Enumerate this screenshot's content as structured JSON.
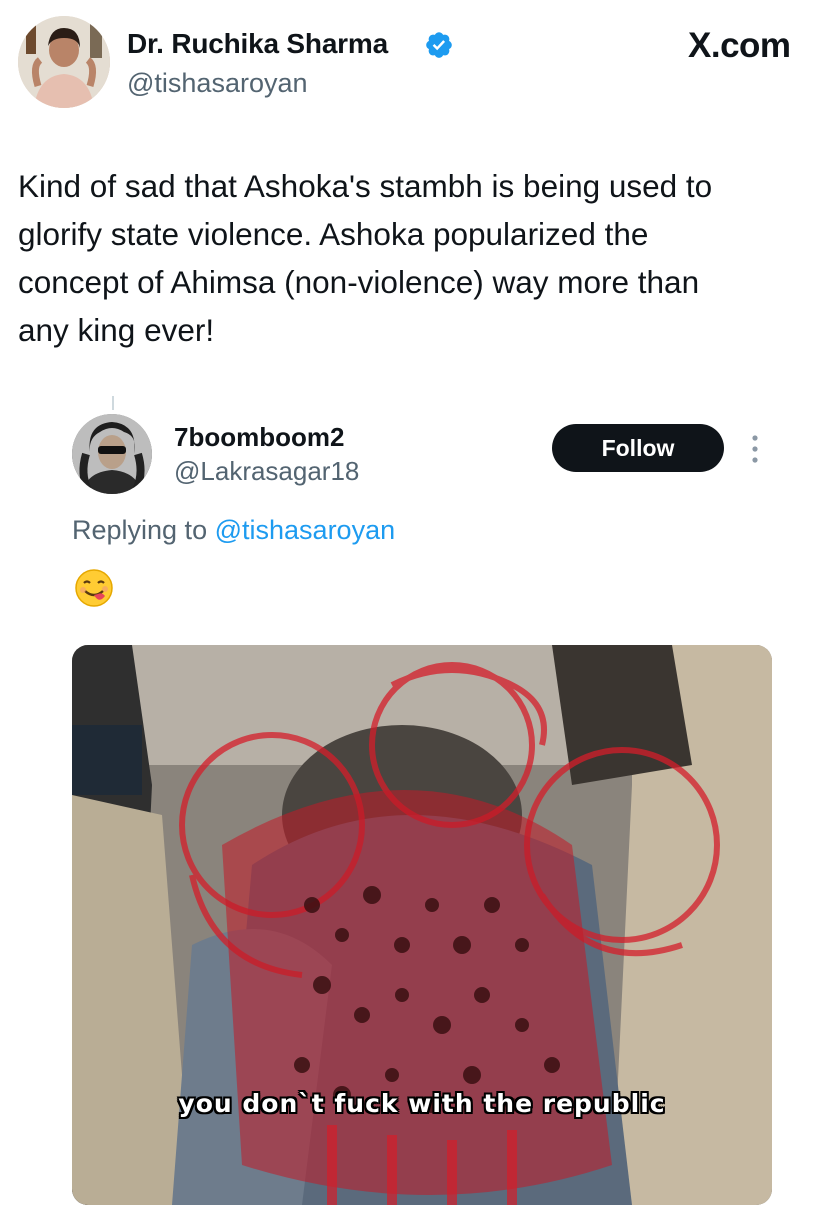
{
  "header": {
    "author_name": "Dr. Ruchika Sharma",
    "author_handle": "@tishasaroyan",
    "site_label": "X.com"
  },
  "tweet": {
    "text": "Kind of sad that Ashoka's stambh is being used to\nglorify state violence. Ashoka popularized the\nconcept of Ahimsa (non-violence) way more than\nany king ever!"
  },
  "reply": {
    "name": "7boomboom2",
    "handle": "@Lakrasagar18",
    "follow_label": "Follow",
    "replying_prefix": "Replying to",
    "replying_to": "@tishasaroyan",
    "emoji": "face-savoring-food"
  },
  "media": {
    "caption": "you don`t fuck with the republic"
  },
  "colors": {
    "accent": "#1d9bf0",
    "text": "#0f1419",
    "muted": "#536471",
    "overlay_red": "#d41e2a"
  }
}
